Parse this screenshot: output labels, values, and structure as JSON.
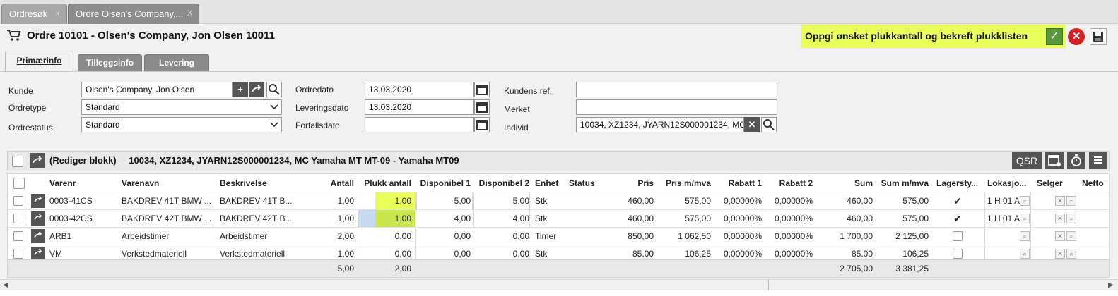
{
  "tabs": [
    {
      "label": "Ordresøk",
      "close": "x"
    },
    {
      "label": "Ordre Olsen's Company,...",
      "close": "X"
    }
  ],
  "header": {
    "title": "Ordre 10101 - Olsen's Company, Jon Olsen 10011",
    "banner": "Oppgi ønsket plukkantall og bekreft plukklisten",
    "ok_glyph": "✓",
    "cancel_glyph": "✕"
  },
  "form_tabs": [
    "Primærinfo",
    "Tilleggsinfo",
    "Levering"
  ],
  "form": {
    "kunde_label": "Kunde",
    "kunde_value": "Olsen's Company, Jon Olsen",
    "ordretype_label": "Ordretype",
    "ordretype_value": "Standard",
    "ordrestatus_label": "Ordrestatus",
    "ordrestatus_value": "Standard",
    "ordredato_label": "Ordredato",
    "ordredato_value": "13.03.2020",
    "leveringsdato_label": "Leveringsdato",
    "leveringsdato_value": "13.03.2020",
    "forfallsdato_label": "Forfallsdato",
    "forfallsdato_value": "",
    "kundens_ref_label": "Kundens ref.",
    "kundens_ref_value": "",
    "merket_label": "Merket",
    "merket_value": "",
    "individ_label": "Individ",
    "individ_value": "10034, XZ1234, JYARN12S000001234, MC"
  },
  "grid": {
    "title_prefix": "(Rediger blokk)",
    "title": "10034, XZ1234, JYARN12S000001234, MC Yamaha MT MT-09 - Yamaha MT09",
    "qsr_label": "QSR",
    "columns": [
      "Varenr",
      "Varenavn",
      "Beskrivelse",
      "Antall",
      "Plukk antall",
      "Disponibel 1",
      "Disponibel 2",
      "Enhet",
      "Status",
      "Pris",
      "Pris m/mva",
      "Rabatt 1",
      "Rabatt 2",
      "Sum",
      "Sum m/mva",
      "Lagersty...",
      "Lokasjo...",
      "Selger",
      "Netto"
    ],
    "rows": [
      {
        "varenr": "0003-41CS",
        "varenavn": "BAKDREV 41T BMW ...",
        "beskrivelse": "BAKDREV 41T B...",
        "antall": "1,00",
        "plukk": "1,00",
        "disp1": "5,00",
        "disp2": "5,00",
        "enhet": "Stk",
        "status": "",
        "pris": "460,00",
        "pris_mva": "575,00",
        "rabatt1": "0,00000%",
        "rabatt2": "0,00000%",
        "sum": "460,00",
        "sum_mva": "575,00",
        "lager": "✔",
        "lokasjon": "1 H 01 A"
      },
      {
        "varenr": "0003-42CS",
        "varenavn": "BAKDREV 42T BMW ...",
        "beskrivelse": "BAKDREV 42T B...",
        "antall": "1,00",
        "plukk": "1,00",
        "disp1": "4,00",
        "disp2": "4,00",
        "enhet": "Stk",
        "status": "",
        "pris": "460,00",
        "pris_mva": "575,00",
        "rabatt1": "0,00000%",
        "rabatt2": "0,00000%",
        "sum": "460,00",
        "sum_mva": "575,00",
        "lager": "✔",
        "lokasjon": "1 H 01 A"
      },
      {
        "varenr": "ARB1",
        "varenavn": "Arbeidstimer",
        "beskrivelse": "Arbeidstimer",
        "antall": "2,00",
        "plukk": "0,00",
        "disp1": "0,00",
        "disp2": "0,00",
        "enhet": "Timer",
        "status": "",
        "pris": "850,00",
        "pris_mva": "1 062,50",
        "rabatt1": "0,00000%",
        "rabatt2": "0,00000%",
        "sum": "1 700,00",
        "sum_mva": "2 125,00",
        "lager": "",
        "lokasjon": ""
      },
      {
        "varenr": "VM",
        "varenavn": "Verkstedmateriell",
        "beskrivelse": "Verkstedmateriell",
        "antall": "1,00",
        "plukk": "0,00",
        "disp1": "0,00",
        "disp2": "0,00",
        "enhet": "Stk",
        "status": "",
        "pris": "85,00",
        "pris_mva": "106,25",
        "rabatt1": "0,00000%",
        "rabatt2": "0,00000%",
        "sum": "85,00",
        "sum_mva": "106,25",
        "lager": "",
        "lokasjon": ""
      }
    ],
    "totals": {
      "antall": "5,00",
      "plukk": "2,00",
      "sum": "2 705,00",
      "sum_mva": "3 381,25"
    }
  },
  "colors": {
    "highlight": "#e8ff5a",
    "ok": "#5a9a3a",
    "cancel": "#d42020"
  }
}
